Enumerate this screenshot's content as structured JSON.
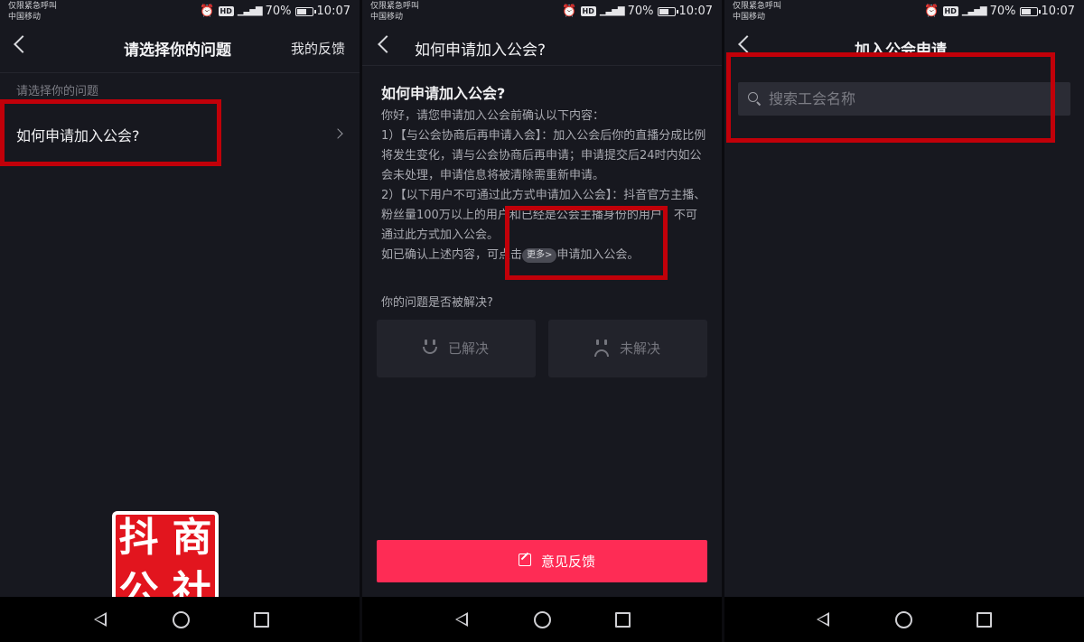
{
  "status_bar": {
    "carrier_line1": "仅限紧急呼叫",
    "carrier_line2": "中国移动",
    "battery": "70%",
    "battery_level": 0.7,
    "time": "10:07",
    "hd": "HD",
    "net": "4G"
  },
  "screen1": {
    "title": "请选择你的问题",
    "action": "我的反馈",
    "section_label": "请选择你的问题",
    "question": "如何申请加入公会?"
  },
  "screen2": {
    "title": "如何申请加入公会?",
    "answer_title": "如何申请加入公会?",
    "answer_lines": [
      "你好，请您申请加入公会前确认以下内容：",
      "1）【与公会协商后再申请入会】：加入公会后你的直播分成比例将发生变化，请与公会协商后再申请；申请提交后24时内如公会未处理，申请信息将被清除需重新申请。",
      "2）【以下用户不可通过此方式申请加入公会】：抖音官方主播、粉丝量100万以上的用户和已经是公会主播身份的用户，不可通过此方式加入公会。"
    ],
    "confirm_prefix": "如已确认上述内容，可点击",
    "more_label": "更多>",
    "confirm_suffix": "申请加入公会。",
    "resolved_question": "你的问题是否被解决?",
    "resolved_label": "已解决",
    "unresolved_label": "未解决",
    "feedback_label": "意见反馈"
  },
  "screen3": {
    "title": "加入公会申请",
    "search_placeholder": "搜索工会名称"
  },
  "logo": {
    "chars": [
      "抖",
      "商",
      "公",
      "社"
    ]
  },
  "colors": {
    "background": "#17181f",
    "accent": "#fe2c55",
    "highlight": "#c10009",
    "logo_red": "#e2151e"
  }
}
